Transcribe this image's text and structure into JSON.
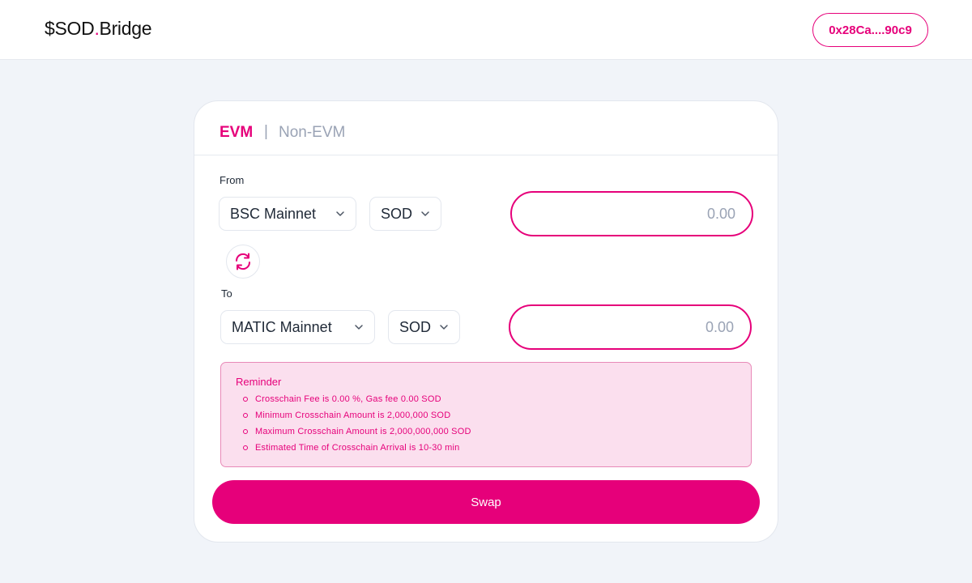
{
  "header": {
    "logo_prefix": "$SOD",
    "logo_dot": ".",
    "logo_suffix": "Bridge",
    "wallet_address": "0x28Ca....90c9"
  },
  "tabs": {
    "evm": "EVM",
    "separator": "|",
    "non_evm": "Non-EVM",
    "active": "EVM"
  },
  "from": {
    "label": "From",
    "network": "BSC Mainnet",
    "token": "SOD",
    "amount_placeholder": "0.00"
  },
  "to": {
    "label": "To",
    "network": "MATIC Mainnet",
    "token": "SOD",
    "amount_placeholder": "0.00"
  },
  "reminder": {
    "title": "Reminder",
    "items": [
      "Crosschain Fee is 0.00 %, Gas fee 0.00 SOD",
      "Minimum Crosschain Amount is 2,000,000 SOD",
      "Maximum Crosschain Amount is 2,000,000,000 SOD",
      "Estimated Time of Crosschain Arrival is 10-30 min"
    ]
  },
  "swap_button": "Swap",
  "colors": {
    "accent": "#e6007a",
    "background": "#f1f4f9",
    "reminder_bg": "#fbdfee",
    "muted": "#9aa3b5"
  },
  "icons": {
    "chevron": "chevron-down-icon",
    "swap_direction": "swap-direction-icon"
  }
}
